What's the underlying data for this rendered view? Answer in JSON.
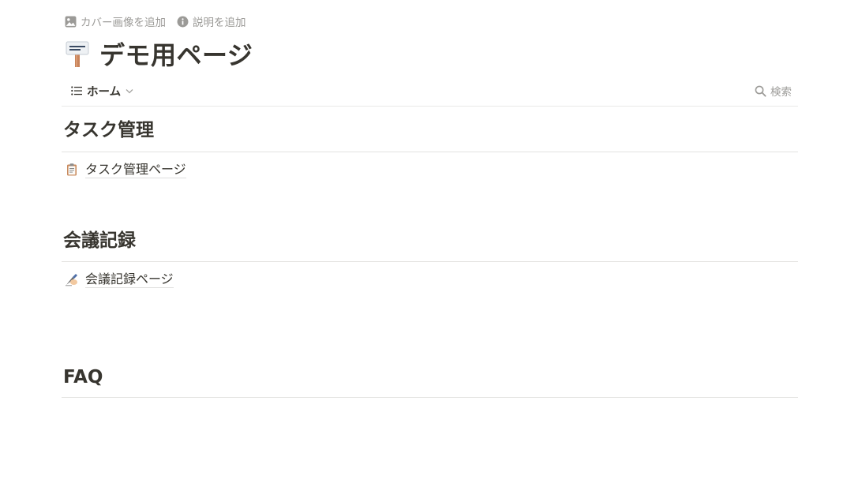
{
  "page_actions": {
    "add_cover": "カバー画像を追加",
    "add_description": "説明を追加"
  },
  "title": "デモ用ページ",
  "page_icon": "signpost-icon",
  "view": {
    "tab_label": "ホーム",
    "search_label": "検索"
  },
  "sections": [
    {
      "heading": "タスク管理",
      "link": {
        "icon": "clipboard-icon",
        "label": "タスク管理ページ"
      }
    },
    {
      "heading": "会議記録",
      "link": {
        "icon": "writing-hand-icon",
        "label": "会議記録ページ"
      }
    },
    {
      "heading": "FAQ"
    }
  ],
  "colors": {
    "text": "#37352f",
    "muted": "#9b9a97",
    "divider": "#e9e9e7"
  }
}
